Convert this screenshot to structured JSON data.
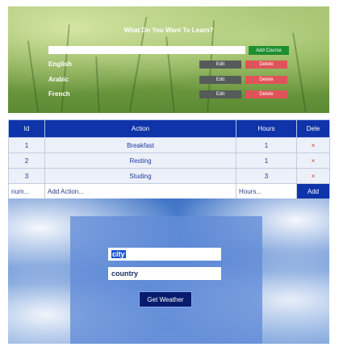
{
  "courses": {
    "heading": "What Do You Want To Learn?",
    "input_value": "",
    "add_label": "Add Course",
    "items": [
      {
        "name": "English",
        "edit": "Edit",
        "delete": "Delete"
      },
      {
        "name": "Arabic",
        "edit": "Edit",
        "delete": "Delete"
      },
      {
        "name": "French",
        "edit": "Edit",
        "delete": "Delete"
      }
    ]
  },
  "actions_table": {
    "headers": [
      "Id",
      "Action",
      "Hours",
      "Dele"
    ],
    "rows": [
      {
        "id": "1",
        "action": "Breakfast",
        "hours": "1",
        "delete": "×"
      },
      {
        "id": "2",
        "action": "Resting",
        "hours": "1",
        "delete": "×"
      },
      {
        "id": "3",
        "action": "Studing",
        "hours": "3",
        "delete": "×"
      }
    ],
    "input_row": {
      "id_placeholder": "num...",
      "action_placeholder": "Add Action...",
      "hours_placeholder": "Hours...",
      "add_label": "Add"
    }
  },
  "weather": {
    "city_value": "city",
    "country_value": "country",
    "button_label": "Get Weather"
  }
}
